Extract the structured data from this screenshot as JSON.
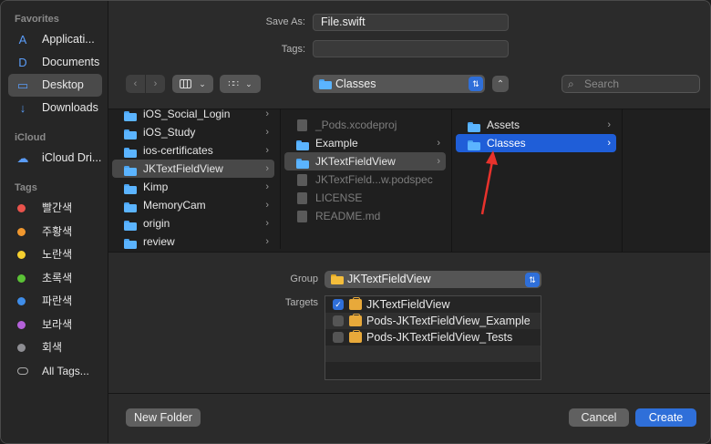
{
  "sidebar": {
    "favorites_title": "Favorites",
    "favorites": [
      {
        "label": "Applicati...",
        "icon": "applications-icon",
        "glyph": "A"
      },
      {
        "label": "Documents",
        "icon": "document-icon",
        "glyph": "D"
      },
      {
        "label": "Desktop",
        "icon": "desktop-icon",
        "glyph": "▭",
        "active": true
      },
      {
        "label": "Downloads",
        "icon": "download-icon",
        "glyph": "↓"
      }
    ],
    "icloud_title": "iCloud",
    "icloud": [
      {
        "label": "iCloud Dri...",
        "icon": "cloud-icon",
        "glyph": "☁"
      }
    ],
    "tags_title": "Tags",
    "tags": [
      {
        "label": "빨간색",
        "color": "#e9534c"
      },
      {
        "label": "주황색",
        "color": "#f0972e"
      },
      {
        "label": "노란색",
        "color": "#f5cf2f"
      },
      {
        "label": "초록색",
        "color": "#5bc236"
      },
      {
        "label": "파란색",
        "color": "#3f8de9"
      },
      {
        "label": "보라색",
        "color": "#b461d9"
      },
      {
        "label": "회색",
        "color": "#8e8e93"
      }
    ],
    "all_tags": "All Tags..."
  },
  "form": {
    "save_as_label": "Save As:",
    "save_as_value": "File.swift",
    "tags_label": "Tags:",
    "tags_value": ""
  },
  "toolbar": {
    "location": "Classes",
    "search_placeholder": "Search"
  },
  "browser": {
    "col1": [
      {
        "label": "iOS_Social_Login",
        "type": "folder",
        "chevron": true
      },
      {
        "label": "iOS_Study",
        "type": "folder",
        "chevron": true
      },
      {
        "label": "ios-certificates",
        "type": "folder",
        "chevron": true
      },
      {
        "label": "JKTextFieldView",
        "type": "folder",
        "chevron": true,
        "state": "sel-grey"
      },
      {
        "label": "Kimp",
        "type": "folder",
        "chevron": true
      },
      {
        "label": "MemoryCam",
        "type": "folder",
        "chevron": true
      },
      {
        "label": "origin",
        "type": "folder",
        "chevron": true
      },
      {
        "label": "review",
        "type": "folder",
        "chevron": true
      }
    ],
    "col2": [
      {
        "label": "_Pods.xcodeproj",
        "type": "doc",
        "chevron": false,
        "state": "dim"
      },
      {
        "label": "Example",
        "type": "folder",
        "chevron": true
      },
      {
        "label": "JKTextFieldView",
        "type": "folder",
        "chevron": true,
        "state": "sel-grey"
      },
      {
        "label": "JKTextField...w.podspec",
        "type": "doc",
        "chevron": false,
        "state": "dim"
      },
      {
        "label": "LICENSE",
        "type": "doc",
        "chevron": false,
        "state": "dim"
      },
      {
        "label": "README.md",
        "type": "doc",
        "chevron": false,
        "state": "dim"
      }
    ],
    "col3": [
      {
        "label": "Assets",
        "type": "folder",
        "chevron": true
      },
      {
        "label": "Classes",
        "type": "folder",
        "chevron": true,
        "state": "sel-blue"
      }
    ]
  },
  "options": {
    "group_label": "Group",
    "group_value": "JKTextFieldView",
    "targets_label": "Targets",
    "targets": [
      {
        "label": "JKTextFieldView",
        "checked": true
      },
      {
        "label": "Pods-JKTextFieldView_Example",
        "checked": false
      },
      {
        "label": "Pods-JKTextFieldView_Tests",
        "checked": false
      }
    ]
  },
  "buttons": {
    "new_folder": "New Folder",
    "cancel": "Cancel",
    "create": "Create"
  },
  "colors": {
    "accent": "#2f6fd9",
    "annotation_arrow": "#e8322c"
  }
}
